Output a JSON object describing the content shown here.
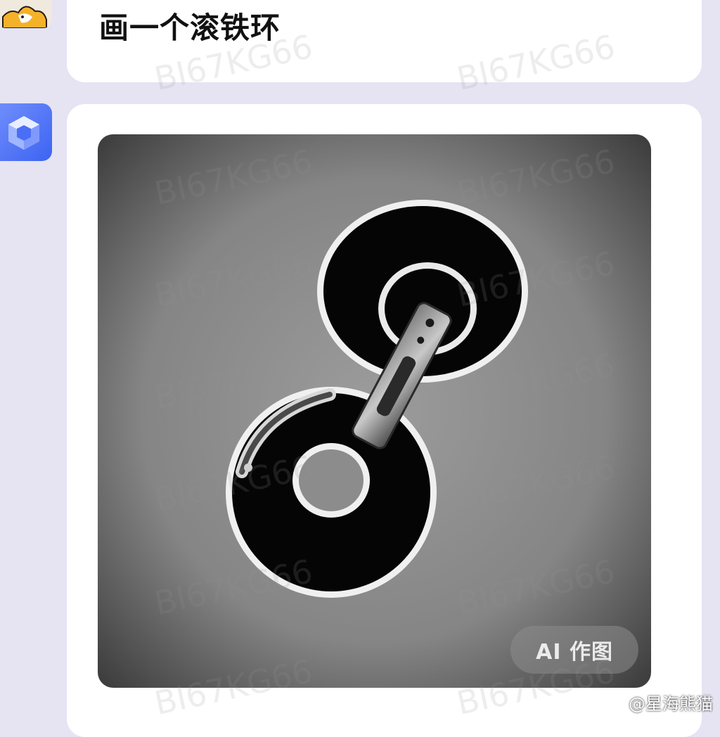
{
  "chat": {
    "user_prompt": "画一个滚铁环"
  },
  "result": {
    "badge_label": "AI 作图",
    "subject_icon": "rolling-iron-hoop-illustration"
  },
  "overlay": {
    "watermark_text": "BI67KG66",
    "credit_text": "@星海熊猫",
    "credit_icon": "weibo-icon"
  },
  "colors": {
    "page_bg": "#e6e4f3",
    "card_bg": "#ffffff",
    "bot_avatar": "#4a6ef5"
  }
}
